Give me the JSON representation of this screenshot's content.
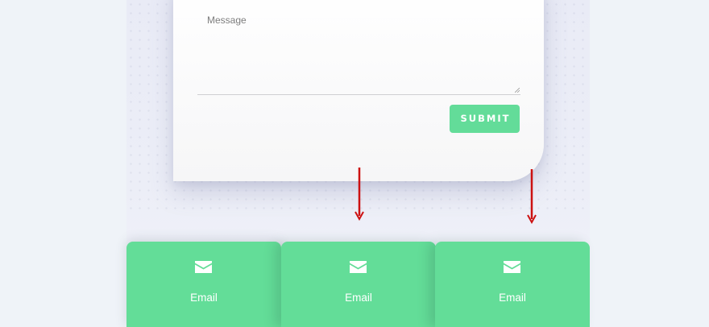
{
  "contact_form": {
    "message_label": "Message",
    "submit_label": "SUBMIT"
  },
  "contact_cards": [
    {
      "icon": "envelope-icon",
      "label": "Email"
    },
    {
      "icon": "envelope-icon",
      "label": "Email"
    },
    {
      "icon": "envelope-icon",
      "label": "Email"
    }
  ],
  "annotations": {
    "arrow_color": "#cc1111"
  },
  "colors": {
    "accent_green": "#63dd98",
    "page_background": "#eff3f8",
    "card_text": "#ffffff"
  }
}
